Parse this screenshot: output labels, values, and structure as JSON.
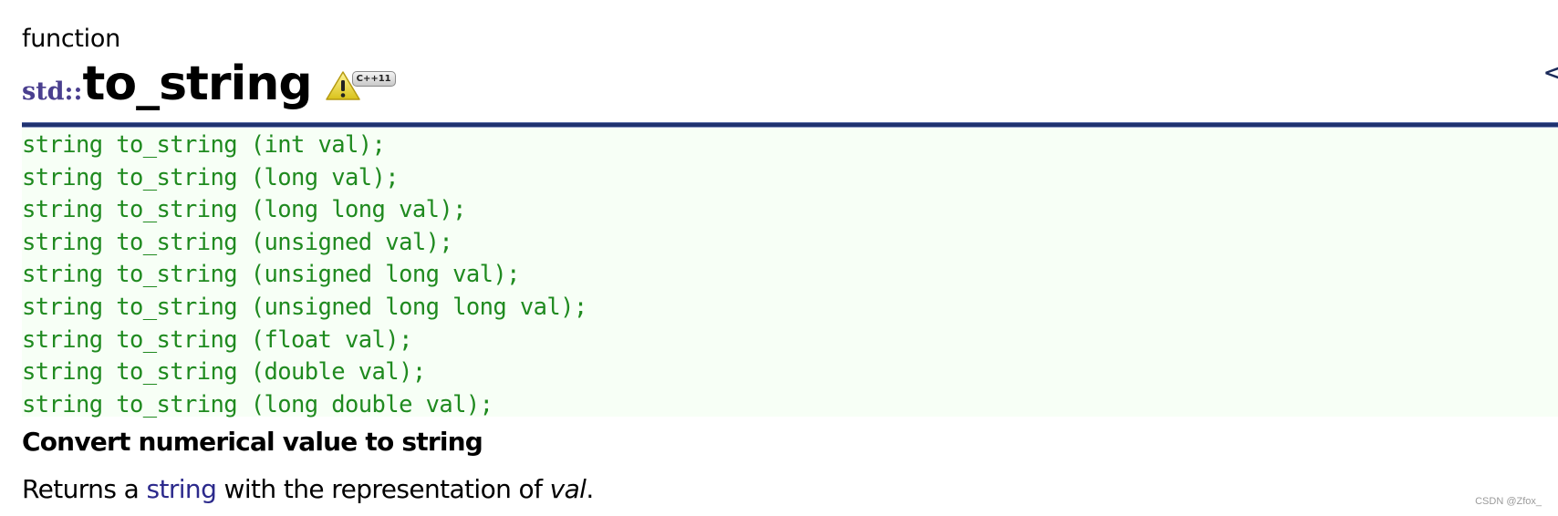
{
  "header": {
    "kind": "function",
    "namespace": "std::",
    "name": "to_string",
    "badges": {
      "warning_icon": "warning-triangle-icon",
      "standard_tag": "C++11"
    },
    "side_link": "<string>"
  },
  "prototypes": [
    "string to_string (int val);",
    "string to_string (long val);",
    "string to_string (long long val);",
    "string to_string (unsigned val);",
    "string to_string (unsigned long val);",
    "string to_string (unsigned long long val);",
    "string to_string (float val);",
    "string to_string (double val);",
    "string to_string (long double val);"
  ],
  "summary": "Convert numerical value to string",
  "description": {
    "prefix": "Returns a ",
    "link": "string",
    "middle": " with the representation of ",
    "param": "val",
    "suffix": "."
  },
  "watermark": "CSDN @Zfox_",
  "colors": {
    "namespace": "#4a3f8f",
    "rule": "#1f3270",
    "code_text": "#1f8a1f",
    "code_background": "#f7fff6",
    "link": "#2c2a8c"
  }
}
